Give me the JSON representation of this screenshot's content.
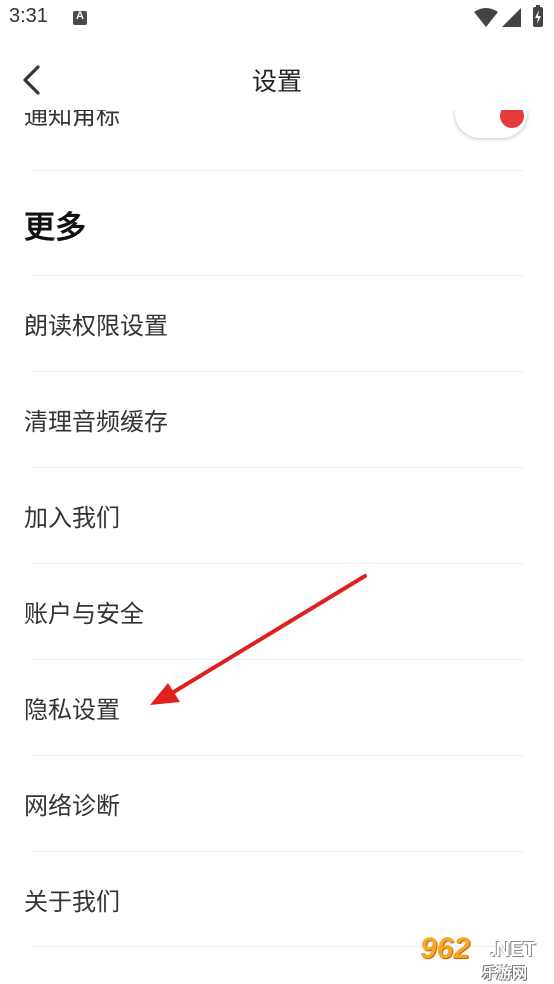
{
  "status_bar": {
    "time": "3:31",
    "notification_icon": "font-a-icon",
    "wifi_icon": "wifi-icon",
    "signal_icon": "signal-icon",
    "battery_icon": "battery-charging-icon"
  },
  "header": {
    "title": "设置",
    "back_icon": "chevron-left-icon"
  },
  "clipped_row": {
    "label": "通知角标",
    "toggle_on": true,
    "toggle_color": "#e63b3b"
  },
  "section": {
    "heading": "更多"
  },
  "menu": {
    "items": [
      {
        "label": "朗读权限设置"
      },
      {
        "label": "清理音频缓存"
      },
      {
        "label": "加入我们"
      },
      {
        "label": "账户与安全"
      },
      {
        "label": "隐私设置"
      },
      {
        "label": "网络诊断"
      },
      {
        "label": "关于我们"
      }
    ]
  },
  "annotation": {
    "color": "#e02020",
    "points_to": "隐私设置"
  },
  "watermark": {
    "main": "962",
    "suffix": ".NET",
    "sub": "乐游网"
  }
}
